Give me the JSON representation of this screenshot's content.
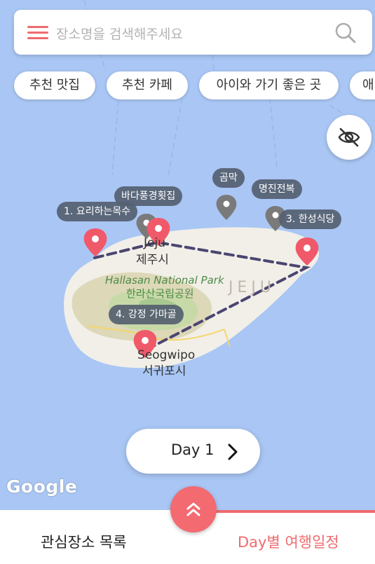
{
  "search": {
    "placeholder": "장소명을 검색해주세요"
  },
  "chips": [
    "추천 맛집",
    "추천 카페",
    "아이와 가기 좋은 곳",
    "애"
  ],
  "map": {
    "places": {
      "p1": "1. 요리하는목수",
      "p2": "바다풍경횟집",
      "p3": "곰막",
      "p4": "명진전복",
      "p5": "3. 한성식당",
      "p6": "4. 강정 가마골"
    },
    "cities": {
      "jeju_en": "Jeju",
      "jeju_ko": "제주시",
      "seogwipo_en": "Seogwipo",
      "seogwipo_ko": "서귀포시"
    },
    "park": {
      "en": "Hallasan National Park",
      "ko": "한라산국립공원"
    },
    "region": "JEJU",
    "attribution": "Google"
  },
  "day_selector": {
    "label": "Day 1"
  },
  "bottom_nav": {
    "left_tab": "관심장소 목록",
    "right_tab": "Day별 여행일정"
  },
  "colors": {
    "accent": "#ef6a6e",
    "water": "#a9c6f4",
    "land": "#f2efe8"
  }
}
